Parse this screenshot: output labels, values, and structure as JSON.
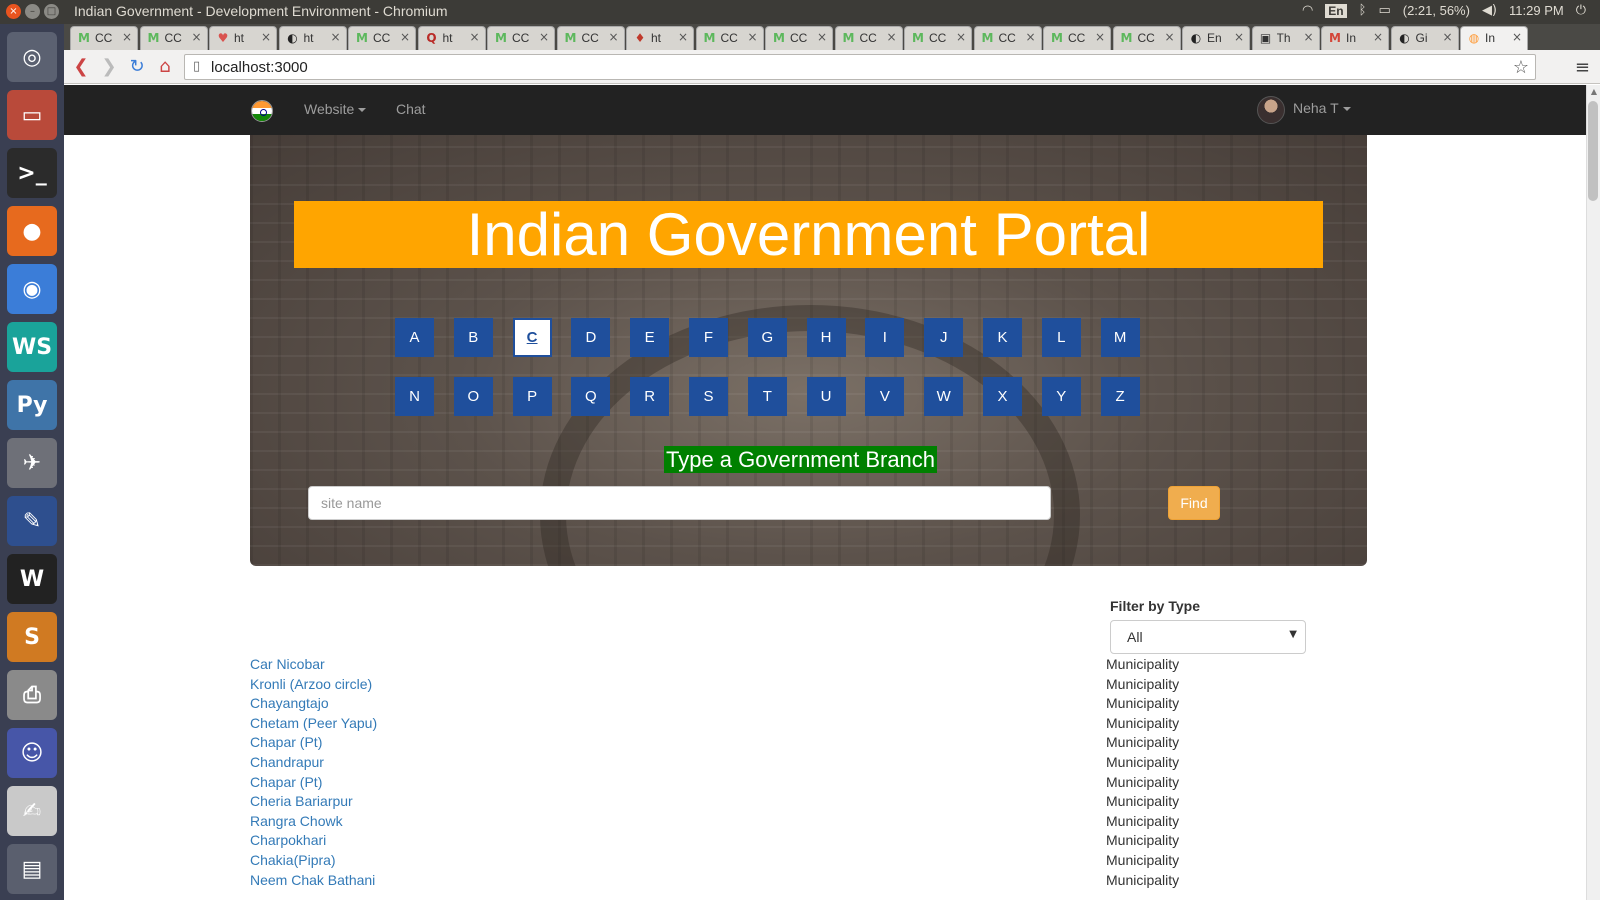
{
  "window": {
    "title": "Indian Government - Development Environment - Chromium",
    "controls": {
      "close": "×",
      "min": "–",
      "max": "□"
    }
  },
  "tray": {
    "lang": "En",
    "battery": "(2:21, 56%)",
    "clock": "11:29 PM",
    "icons": {
      "wifi": "wifi-icon",
      "bluetooth": "bluetooth-icon",
      "battery": "battery-icon",
      "volume": "volume-icon",
      "power": "power-icon"
    }
  },
  "launcher": {
    "items": [
      {
        "name": "ubuntu-dash-icon",
        "glyph": "◎",
        "color": "#5b6171"
      },
      {
        "name": "files-icon",
        "glyph": "▭",
        "color": "#b94a3a"
      },
      {
        "name": "terminal-icon",
        "glyph": ">_",
        "color": "#2b2b2b"
      },
      {
        "name": "firefox-icon",
        "glyph": "●",
        "color": "#e76a1e"
      },
      {
        "name": "chromium-icon",
        "glyph": "◉",
        "color": "#3b7dd8"
      },
      {
        "name": "webstorm-icon",
        "glyph": "WS",
        "color": "#1aa39a"
      },
      {
        "name": "python-icon",
        "glyph": "Py",
        "color": "#3f74a8"
      },
      {
        "name": "launcher-app-icon",
        "glyph": "✈",
        "color": "#6e7078"
      },
      {
        "name": "pencil-app-icon",
        "glyph": "✎",
        "color": "#2e4f8e"
      },
      {
        "name": "wine-icon",
        "glyph": "W",
        "color": "#222222"
      },
      {
        "name": "sublime-text-icon",
        "glyph": "S",
        "color": "#d07a22"
      },
      {
        "name": "printer-icon",
        "glyph": "⎙",
        "color": "#8a8a8a"
      },
      {
        "name": "pidgin-icon",
        "glyph": "☺",
        "color": "#4756a8"
      },
      {
        "name": "text-editor-icon",
        "glyph": "✍",
        "color": "#c9c9c9"
      },
      {
        "name": "trash-icon",
        "glyph": "▤",
        "color": "#5a5f6e"
      }
    ]
  },
  "tabs": [
    {
      "favicon": "M",
      "fav_color": "#5cb85c",
      "title": "CC"
    },
    {
      "favicon": "M",
      "fav_color": "#5cb85c",
      "title": "CC"
    },
    {
      "favicon": "♥",
      "fav_color": "#d9534f",
      "title": "ht"
    },
    {
      "favicon": "◐",
      "fav_color": "#222222",
      "title": "ht"
    },
    {
      "favicon": "M",
      "fav_color": "#5cb85c",
      "title": "CC"
    },
    {
      "favicon": "Q",
      "fav_color": "#b92b27",
      "title": "ht"
    },
    {
      "favicon": "M",
      "fav_color": "#5cb85c",
      "title": "CC"
    },
    {
      "favicon": "M",
      "fav_color": "#5cb85c",
      "title": "CC"
    },
    {
      "favicon": "♦",
      "fav_color": "#c0392b",
      "title": "ht"
    },
    {
      "favicon": "M",
      "fav_color": "#5cb85c",
      "title": "CC"
    },
    {
      "favicon": "M",
      "fav_color": "#5cb85c",
      "title": "CC"
    },
    {
      "favicon": "M",
      "fav_color": "#5cb85c",
      "title": "CC"
    },
    {
      "favicon": "M",
      "fav_color": "#5cb85c",
      "title": "CC"
    },
    {
      "favicon": "M",
      "fav_color": "#5cb85c",
      "title": "CC"
    },
    {
      "favicon": "M",
      "fav_color": "#5cb85c",
      "title": "CC"
    },
    {
      "favicon": "M",
      "fav_color": "#5cb85c",
      "title": "CC"
    },
    {
      "favicon": "◐",
      "fav_color": "#222222",
      "title": "En"
    },
    {
      "favicon": "▣",
      "fav_color": "#333333",
      "title": "Th"
    },
    {
      "favicon": "M",
      "fav_color": "#d44638",
      "title": "In"
    },
    {
      "favicon": "◐",
      "fav_color": "#222222",
      "title": "Gi"
    },
    {
      "favicon": "◍",
      "fav_color": "#f93",
      "title": "In",
      "active": true
    }
  ],
  "toolbar": {
    "url": "localhost:3000",
    "back": "❮",
    "forward": "❯",
    "reload": "↻",
    "home": "⌂",
    "star": "☆",
    "menu": "≡",
    "page": "▯"
  },
  "navbar": {
    "website_label": "Website",
    "chat_label": "Chat",
    "user_name": "Neha T"
  },
  "hero": {
    "title": "Indian Government Portal",
    "letters_row1": [
      "A",
      "B",
      "C",
      "D",
      "E",
      "F",
      "G",
      "H",
      "I",
      "J",
      "K",
      "L",
      "M"
    ],
    "letters_row2": [
      "N",
      "O",
      "P",
      "Q",
      "R",
      "S",
      "T",
      "U",
      "V",
      "W",
      "X",
      "Y",
      "Z"
    ],
    "selected_letter": "C",
    "search_label": "Type a Government Branch",
    "search_placeholder": "site name",
    "find_label": "Find"
  },
  "filter": {
    "label": "Filter by Type",
    "selected": "All",
    "arrow": "▼"
  },
  "results": [
    {
      "name": "Car Nicobar",
      "type": "Municipality"
    },
    {
      "name": "Kronli (Arzoo circle)",
      "type": "Municipality"
    },
    {
      "name": "Chayangtajo",
      "type": "Municipality"
    },
    {
      "name": "Chetam (Peer Yapu)",
      "type": "Municipality"
    },
    {
      "name": "Chapar (Pt)",
      "type": "Municipality"
    },
    {
      "name": "Chandrapur",
      "type": "Municipality"
    },
    {
      "name": "Chapar (Pt)",
      "type": "Municipality"
    },
    {
      "name": "Cheria Bariarpur",
      "type": "Municipality"
    },
    {
      "name": "Rangra Chowk",
      "type": "Municipality"
    },
    {
      "name": "Charpokhari",
      "type": "Municipality"
    },
    {
      "name": "Chakia(Pipra)",
      "type": "Municipality"
    },
    {
      "name": "Neem Chak Bathani",
      "type": "Municipality"
    }
  ]
}
